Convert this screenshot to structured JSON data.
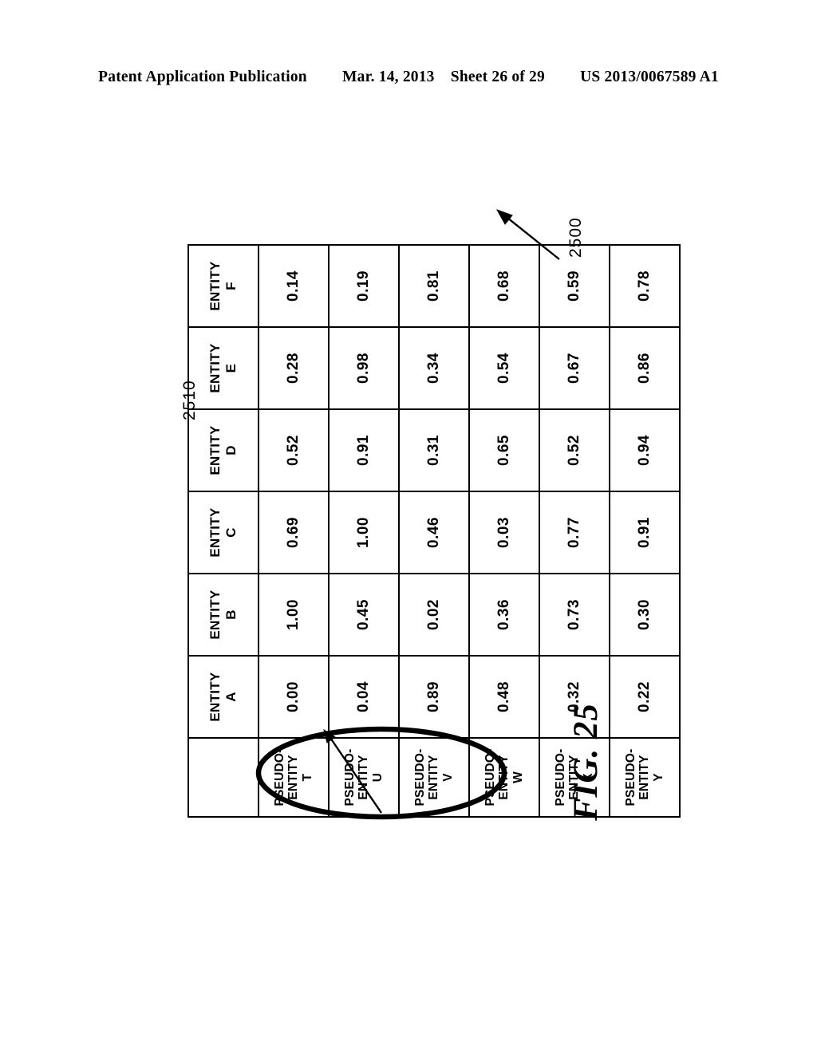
{
  "header": {
    "publication": "Patent Application Publication",
    "date": "Mar. 14, 2013",
    "sheet": "Sheet 26 of 29",
    "patent_number": "US 2013/0067589 A1"
  },
  "figure": {
    "caption": "FIG. 25",
    "reference_numeral_figure": "2500",
    "reference_numeral_highlight": "2510"
  },
  "chart_data": {
    "type": "table",
    "title": "FIG. 25",
    "corner_label": "",
    "columns": [
      "ENTITY A",
      "ENTITY B",
      "ENTITY C",
      "ENTITY D",
      "ENTITY E",
      "ENTITY F"
    ],
    "column_heads": [
      {
        "line1": "ENTITY",
        "line2": "A"
      },
      {
        "line1": "ENTITY",
        "line2": "B"
      },
      {
        "line1": "ENTITY",
        "line2": "C"
      },
      {
        "line1": "ENTITY",
        "line2": "D"
      },
      {
        "line1": "ENTITY",
        "line2": "E"
      },
      {
        "line1": "ENTITY",
        "line2": "F"
      }
    ],
    "rows": [
      "PSEUDO-ENTITY T",
      "PSEUDO-ENTITY U",
      "PSEUDO-ENTITY V",
      "PSEUDO-ENTITY W",
      "PSEUDO-ENTITY X",
      "PSEUDO-ENTITY Y"
    ],
    "row_heads": [
      {
        "line1": "PSEUDO-",
        "line2": "ENTITY",
        "line3": "T"
      },
      {
        "line1": "PSEUDO-",
        "line2": "ENTITY",
        "line3": "U"
      },
      {
        "line1": "PSEUDO-",
        "line2": "ENTITY",
        "line3": "V"
      },
      {
        "line1": "PSEUDO-",
        "line2": "ENTITY",
        "line3": "W"
      },
      {
        "line1": "PSEUDO-",
        "line2": "ENTITY",
        "line3": "X"
      },
      {
        "line1": "PSEUDO-",
        "line2": "ENTITY",
        "line3": "Y"
      }
    ],
    "values": [
      [
        "0.00",
        "1.00",
        "0.69",
        "0.52",
        "0.28",
        "0.14"
      ],
      [
        "0.04",
        "0.45",
        "1.00",
        "0.91",
        "0.98",
        "0.19"
      ],
      [
        "0.89",
        "0.02",
        "0.46",
        "0.31",
        "0.34",
        "0.81"
      ],
      [
        "0.48",
        "0.36",
        "0.03",
        "0.65",
        "0.54",
        "0.68"
      ],
      [
        "0.32",
        "0.73",
        "0.77",
        "0.52",
        "0.67",
        "0.59"
      ],
      [
        "0.22",
        "0.30",
        "0.91",
        "0.94",
        "0.86",
        "0.78"
      ]
    ],
    "highlight": {
      "label": "2510",
      "row": "PSEUDO-ENTITY T",
      "columns": [
        "ENTITY B",
        "ENTITY C",
        "ENTITY D"
      ],
      "values": [
        "1.00",
        "0.69",
        "0.52"
      ],
      "shape": "ellipse"
    }
  },
  "colors": {
    "ink": "#000000",
    "paper": "#ffffff"
  }
}
